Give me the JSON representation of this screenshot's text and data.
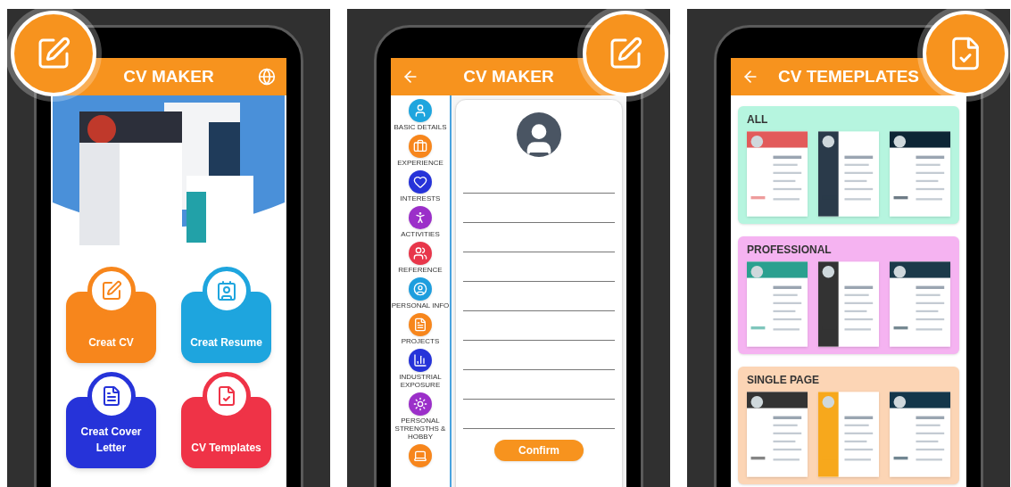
{
  "screens": [
    {
      "kind": "home",
      "title": "CV MAKER",
      "menu": [
        {
          "label": "Creat CV",
          "color": "#f7861c"
        },
        {
          "label": "Creat Resume",
          "color": "#1ea5de"
        },
        {
          "label": "Creat Cover Letter",
          "color": "#2633d9"
        },
        {
          "label": "CV Templates",
          "color": "#ef3347"
        }
      ]
    },
    {
      "kind": "form",
      "title": "CV MAKER",
      "sections": [
        {
          "label": "BASIC DETAILS",
          "color": "#1ea5de"
        },
        {
          "label": "EXPERIENCE",
          "color": "#f7861c"
        },
        {
          "label": "INTERESTS",
          "color": "#2633d9"
        },
        {
          "label": "ACTIVITIES",
          "color": "#9b2fc9"
        },
        {
          "label": "REFERENCE",
          "color": "#e8364a"
        },
        {
          "label": "PERSONAL INFO",
          "color": "#1e9ede"
        },
        {
          "label": "PROJECTS",
          "color": "#f7861c"
        },
        {
          "label": "INDUSTRIAL EXPOSURE",
          "color": "#2633d9"
        },
        {
          "label": "PERSONAL STRENGTHS & HOBBY",
          "color": "#9b2fc9"
        },
        {
          "color": "#f7861c"
        }
      ],
      "confirm": "Confirm"
    },
    {
      "kind": "templates",
      "title": "CV TEMEPLATES",
      "groups": [
        {
          "title": "ALL",
          "color": "#b6f5df"
        },
        {
          "title": "PROFESSIONAL",
          "color": "#f5b3f1"
        },
        {
          "title": "SINGLE PAGE",
          "color": "#fcd5b5"
        }
      ]
    }
  ]
}
